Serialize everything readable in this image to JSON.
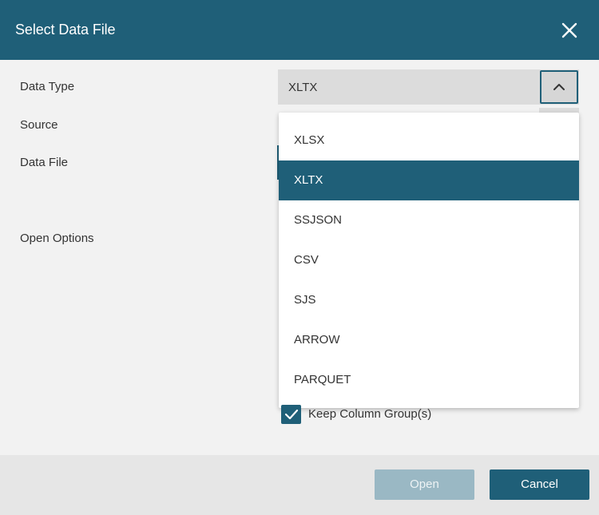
{
  "dialog": {
    "title": "Select Data File"
  },
  "form": {
    "data_type_label": "Data Type",
    "source_label": "Source",
    "data_file_label": "Data File",
    "open_options_label": "Open Options",
    "data_type_value": "XLTX"
  },
  "dropdown": {
    "options": [
      "XLSX",
      "XLTX",
      "SSJSON",
      "CSV",
      "SJS",
      "ARROW",
      "PARQUET"
    ],
    "selected": "XLTX"
  },
  "options": {
    "keep_column_groups_label": "Keep Column Group(s)",
    "keep_column_groups_checked": true
  },
  "footer": {
    "open_label": "Open",
    "cancel_label": "Cancel"
  },
  "colors": {
    "accent": "#1f5f78",
    "disabled_button": "#9ab8c4",
    "background": "#f2f2f2"
  }
}
